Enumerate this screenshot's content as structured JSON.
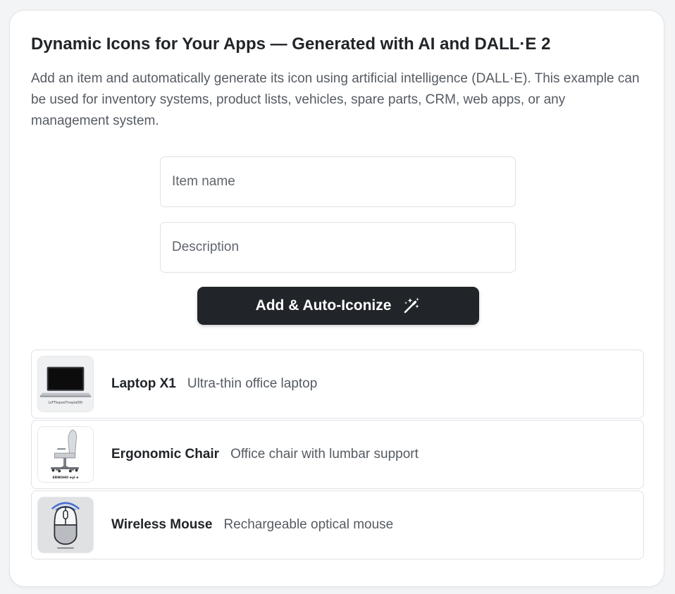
{
  "header": {
    "title": "Dynamic Icons for Your Apps — Generated with AI and DALL·E 2",
    "description": "Add an item and automatically generate its icon using artificial intelligence (DALL·E). This example can be used for inventory systems, product lists, vehicles, spare parts, CRM, web apps, or any management system."
  },
  "form": {
    "name_placeholder": "Item name",
    "name_value": "",
    "description_placeholder": "Description",
    "description_value": "",
    "submit_label": "Add & Auto-Iconize",
    "submit_icon": "magic-wand-icon"
  },
  "items": [
    {
      "name": "Laptop X1",
      "description": "Ultra-thin office laptop",
      "icon": "laptop-image",
      "icon_caption": "LoFTkepoeTlnaptaDIG"
    },
    {
      "name": "Ergonomic Chair",
      "description": "Office chair with lumbar support",
      "icon": "chair-image",
      "icon_caption": "ERNOHO eyl e"
    },
    {
      "name": "Wireless Mouse",
      "description": "Rechargeable optical mouse",
      "icon": "mouse-image",
      "icon_caption": ""
    }
  ],
  "colors": {
    "button_bg": "#212529",
    "accent_blue": "#4a6fd0",
    "page_bg": "#f3f4f6"
  }
}
